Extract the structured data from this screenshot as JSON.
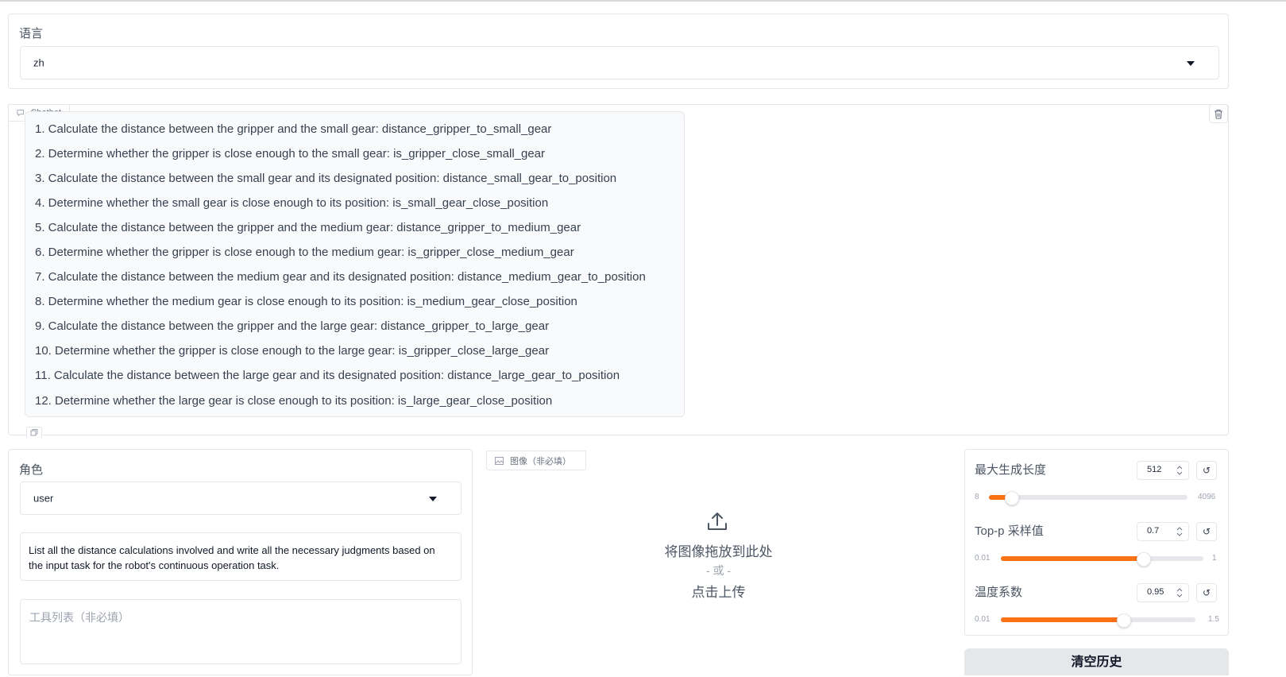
{
  "language": {
    "label": "语言",
    "selected": "zh"
  },
  "chatbot": {
    "label": "Chatbot",
    "lines": [
      "1. Calculate the distance between the gripper and the small gear: distance_gripper_to_small_gear",
      "2. Determine whether the gripper is close enough to the small gear: is_gripper_close_small_gear",
      "3. Calculate the distance between the small gear and its designated position: distance_small_gear_to_position",
      "4. Determine whether the small gear is close enough to its position: is_small_gear_close_position",
      "5. Calculate the distance between the gripper and the medium gear: distance_gripper_to_medium_gear",
      "6. Determine whether the gripper is close enough to the medium gear: is_gripper_close_medium_gear",
      "7. Calculate the distance between the medium gear and its designated position: distance_medium_gear_to_position",
      "8. Determine whether the medium gear is close enough to its position: is_medium_gear_close_position",
      "9. Calculate the distance between the gripper and the large gear: distance_gripper_to_large_gear",
      "10. Determine whether the gripper is close enough to the large gear: is_gripper_close_large_gear",
      "11. Calculate the distance between the large gear and its designated position: distance_large_gear_to_position",
      "12. Determine whether the large gear is close enough to its position: is_large_gear_close_position"
    ]
  },
  "role": {
    "label": "角色",
    "selected": "user"
  },
  "prompt": {
    "value": "List all the distance calculations involved and write all the necessary judgments based on the input task for the robot's continuous operation task."
  },
  "tools": {
    "placeholder": "工具列表（非必填）"
  },
  "image_upload": {
    "label": "图像（非必填）",
    "drop_text": "将图像拖放到此处",
    "or_text": "- 或 -",
    "click_text": "点击上传"
  },
  "sliders": {
    "max_length": {
      "label": "最大生成长度",
      "value": "512",
      "min": "8",
      "max": "4096",
      "fraction": 0.11
    },
    "top_p": {
      "label": "Top-p 采样值",
      "value": "0.7",
      "min": "0.01",
      "max": "1",
      "fraction": 0.7
    },
    "temperature": {
      "label": "温度系数",
      "value": "0.95",
      "min": "0.01",
      "max": "1.5",
      "fraction": 0.63
    }
  },
  "buttons": {
    "clear_history": "清空历史"
  },
  "colors": {
    "accent": "#f97316",
    "border": "#e5e7eb",
    "muted": "#9ca3af"
  }
}
